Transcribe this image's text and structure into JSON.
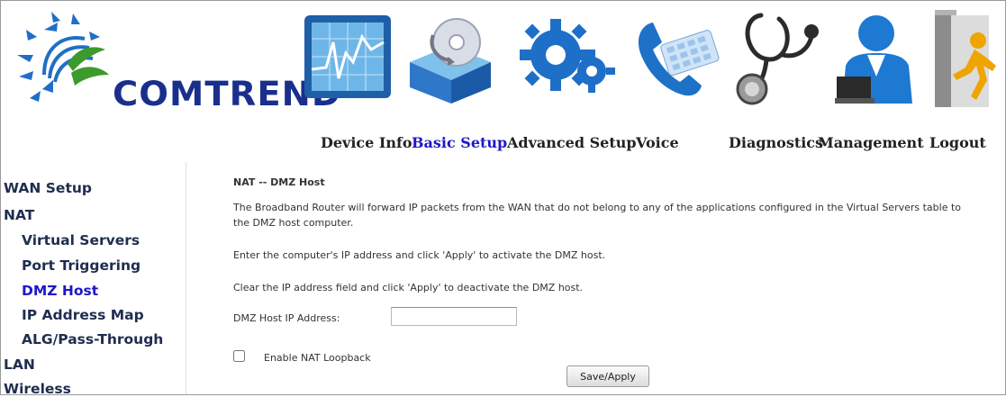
{
  "brand": {
    "name": "COMTREND"
  },
  "nav": {
    "items": [
      {
        "label": "Device Info"
      },
      {
        "label": "Basic Setup"
      },
      {
        "label": "Advanced Setup"
      },
      {
        "label": "Voice"
      },
      {
        "label": "Diagnostics"
      },
      {
        "label": "Management"
      },
      {
        "label": "Logout"
      }
    ],
    "active": "Basic Setup"
  },
  "sidebar": {
    "items": [
      {
        "label": "WAN Setup"
      },
      {
        "label": "NAT"
      },
      {
        "label": "Virtual Servers"
      },
      {
        "label": "Port Triggering"
      },
      {
        "label": "DMZ Host"
      },
      {
        "label": "IP Address Map"
      },
      {
        "label": "ALG/Pass-Through"
      },
      {
        "label": "LAN"
      },
      {
        "label": "Wireless"
      }
    ],
    "active": "DMZ Host"
  },
  "main": {
    "title": "NAT -- DMZ Host",
    "description_line1": "The Broadband Router will forward IP packets from the WAN that do not belong to any of the applications configured in the Virtual Servers table to",
    "description_line2": "the DMZ host computer.",
    "instruction_apply": "Enter the computer's IP address and click 'Apply' to activate the DMZ host.",
    "instruction_clear": "Clear the IP address field and click 'Apply' to deactivate the DMZ host.",
    "ip_label": "DMZ Host IP Address:",
    "ip_value": "",
    "loopback_label": "Enable NAT Loopback",
    "loopback_checked": false,
    "save_label": "Save/Apply"
  },
  "colors": {
    "brand": "#1a2f8c",
    "active_link": "#1e18c8",
    "menu_text": "#1f2d4f"
  },
  "icons": [
    "comtrend-logo-icon",
    "device-info-icon",
    "basic-setup-icon",
    "advanced-setup-icon",
    "voice-icon",
    "diagnostics-icon",
    "management-icon",
    "logout-icon"
  ]
}
